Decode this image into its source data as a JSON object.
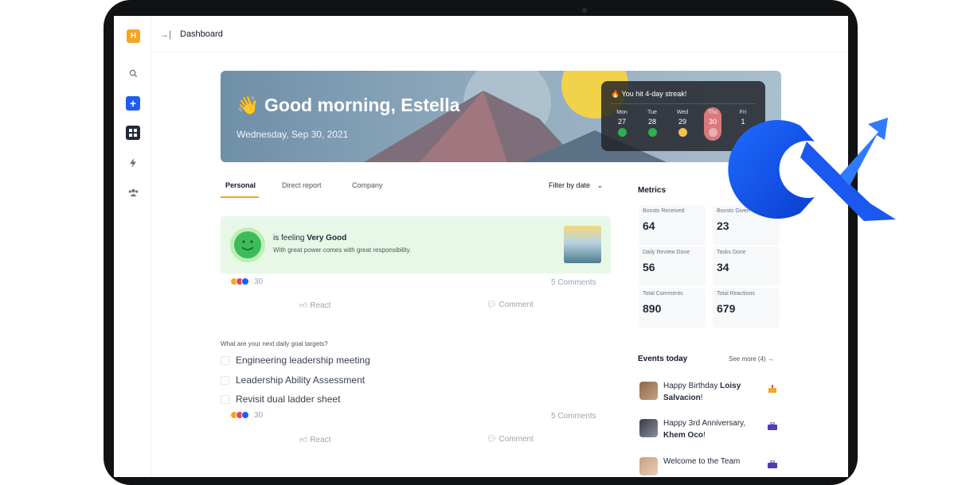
{
  "sidebar": {
    "logo_letter": "H",
    "items": [
      {
        "name": "search-icon"
      },
      {
        "name": "add-icon"
      },
      {
        "name": "grid-icon"
      },
      {
        "name": "bolt-icon"
      },
      {
        "name": "people-icon"
      }
    ]
  },
  "header": {
    "breadcrumb": "Dashboard"
  },
  "hero": {
    "greeting": "👋 Good morning, Estella",
    "date": "Wednesday, Sep 30, 2021",
    "streak_title": "🔥 You hit 4-day streak!",
    "days": [
      {
        "name": "Mon",
        "date": "27",
        "color": "#2fb04f"
      },
      {
        "name": "Tue",
        "date": "28",
        "color": "#2fb04f"
      },
      {
        "name": "Wed",
        "date": "29",
        "color": "#f2c14e"
      },
      {
        "name": "Thu",
        "date": "30",
        "color": "#e06a74"
      },
      {
        "name": "Fri",
        "date": "1",
        "color": ""
      }
    ]
  },
  "tabs": {
    "personal": "Personal",
    "direct_report": "Direct report",
    "company": "Company",
    "filter": "Filter by date"
  },
  "feeling_post": {
    "prefix": "is feeling ",
    "mood": "Very Good",
    "quote": "With great power comes with great responsibility.",
    "reaction_count": "30",
    "comments": "5 Comments",
    "react_label": "React",
    "comment_label": "Comment"
  },
  "goals": {
    "question": "What are your next daily goal targets?",
    "items": [
      "Engineering leadership meeting",
      "Leadership Ability Assessment",
      "Revisit dual ladder sheet"
    ],
    "reaction_count": "30",
    "comments": "5 Comments",
    "react_label": "React",
    "comment_label": "Comment"
  },
  "metrics": {
    "title": "Metrics",
    "items": [
      {
        "label": "Boosts Received",
        "value": "64"
      },
      {
        "label": "Boosts Given",
        "value": "23"
      },
      {
        "label": "Daily Review Done",
        "value": "56"
      },
      {
        "label": "Tasks Done",
        "value": "34"
      },
      {
        "label": "Total Comments",
        "value": "890"
      },
      {
        "label": "Total Reactions",
        "value": "679"
      }
    ]
  },
  "events": {
    "title": "Events today",
    "see_more": "See more (4) →",
    "items": [
      {
        "text": "Happy Birthday ",
        "name": "Loisy Salvacion",
        "suffix": "!",
        "icon": "cake-icon"
      },
      {
        "text": "Happy 3rd Anniversary, ",
        "name": "Khem Oco",
        "suffix": "!",
        "icon": "briefcase-icon"
      },
      {
        "text": "Welcome to the Team",
        "name": "",
        "suffix": "",
        "icon": "briefcase-icon"
      }
    ]
  },
  "colors": {
    "accent": "#1d5cf5",
    "tab_underline": "#f5a524",
    "feeling_bg": "#e8f8e7",
    "mood_face": "#3cbc58"
  }
}
